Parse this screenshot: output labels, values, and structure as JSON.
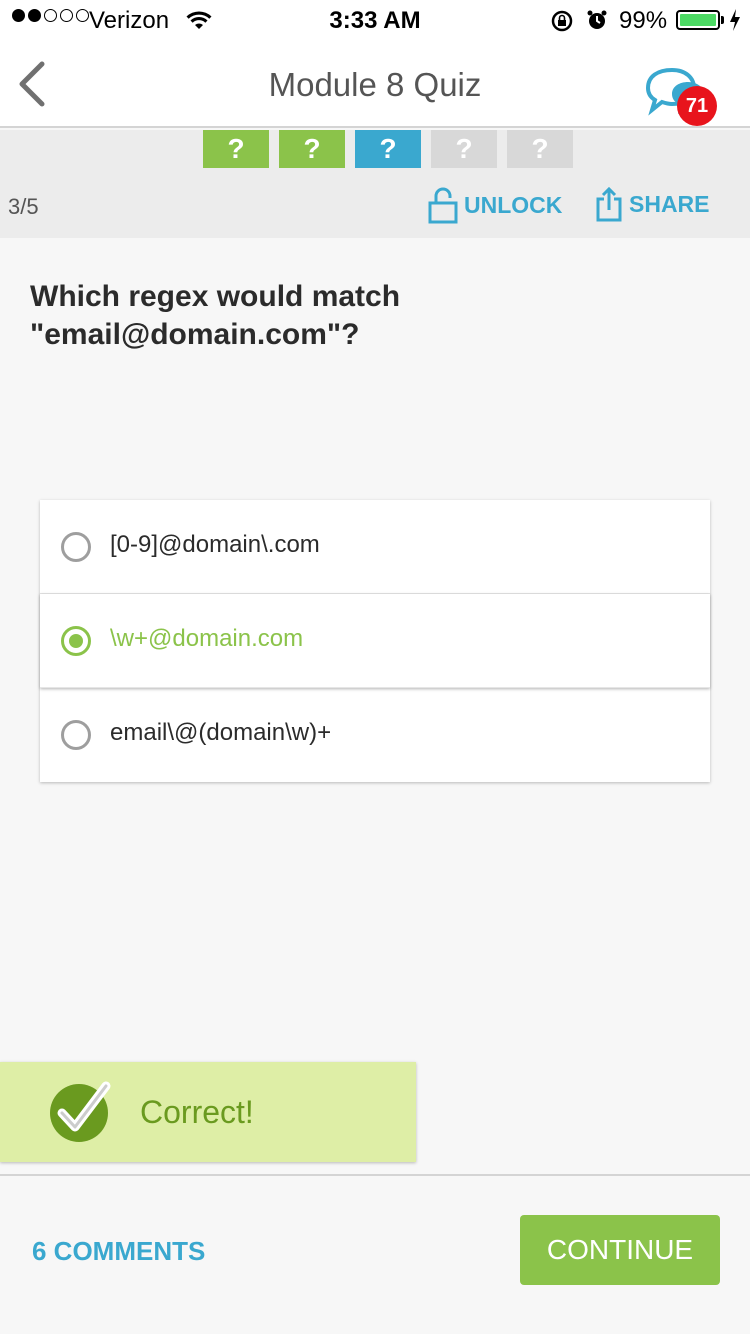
{
  "status_bar": {
    "carrier": "Verizon",
    "time": "3:33 AM",
    "battery": "99%",
    "signal_bars_filled": 2,
    "signal_bars_total": 5
  },
  "nav": {
    "title": "Module 8 Quiz",
    "chat_badge": "71"
  },
  "progress": {
    "steps": [
      {
        "label": "?",
        "state": "done"
      },
      {
        "label": "?",
        "state": "done"
      },
      {
        "label": "?",
        "state": "current"
      },
      {
        "label": "?",
        "state": "todo"
      },
      {
        "label": "?",
        "state": "todo"
      }
    ],
    "counter": "3/5",
    "unlock_label": "UNLOCK",
    "share_label": "SHARE"
  },
  "question": {
    "text": "Which regex would match \"email@domain.com\"?"
  },
  "options": [
    {
      "text": "[0-9]@domain\\.com",
      "selected": false
    },
    {
      "text": "\\w+@domain.com",
      "selected": true
    },
    {
      "text": "email\\@(domain\\w)+",
      "selected": false
    }
  ],
  "feedback": {
    "text": "Correct!"
  },
  "footer": {
    "comments_label": "6 COMMENTS",
    "continue_label": "CONTINUE"
  },
  "colors": {
    "accent_green": "#8bc34a",
    "accent_blue": "#3aa8cf",
    "badge_red": "#e8141c",
    "feedback_bg": "#deeea6"
  }
}
